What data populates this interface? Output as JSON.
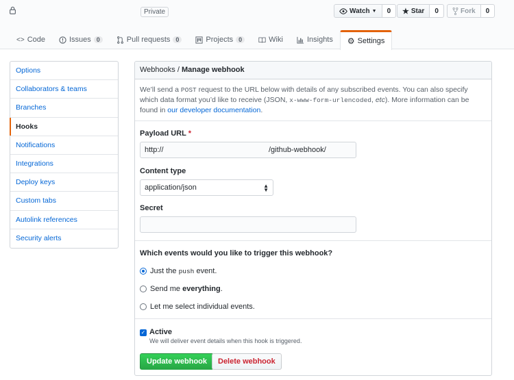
{
  "header": {
    "visibility_badge": "Private",
    "icons": {
      "lock": "lock-icon",
      "watch": "eye-icon",
      "star": "star-icon",
      "fork": "fork-icon"
    },
    "watch": {
      "label": "Watch",
      "count": "0"
    },
    "star": {
      "label": "Star",
      "count": "0"
    },
    "fork": {
      "label": "Fork",
      "count": "0"
    }
  },
  "tabs": [
    {
      "label": "Code",
      "icon": "code-icon"
    },
    {
      "label": "Issues",
      "count": "0",
      "icon": "issue-icon"
    },
    {
      "label": "Pull requests",
      "count": "0",
      "icon": "pull-request-icon"
    },
    {
      "label": "Projects",
      "count": "0",
      "icon": "project-icon"
    },
    {
      "label": "Wiki",
      "icon": "book-icon"
    },
    {
      "label": "Insights",
      "icon": "graph-icon"
    },
    {
      "label": "Settings",
      "icon": "gear-icon",
      "selected": true
    }
  ],
  "sidebar": {
    "items": [
      {
        "label": "Options"
      },
      {
        "label": "Collaborators & teams"
      },
      {
        "label": "Branches"
      },
      {
        "label": "Hooks",
        "selected": true
      },
      {
        "label": "Notifications"
      },
      {
        "label": "Integrations"
      },
      {
        "label": "Deploy keys"
      },
      {
        "label": "Custom tabs"
      },
      {
        "label": "Autolink references"
      },
      {
        "label": "Security alerts"
      }
    ]
  },
  "panel": {
    "breadcrumb_parent": "Webhooks",
    "breadcrumb_sep": " / ",
    "breadcrumb_current": "Manage webhook",
    "intro": {
      "t1": "We’ll send a ",
      "code1": "POST",
      "t2": " request to the URL below with details of any subscribed events. You can also specify which data format you’d like to receive (JSON, ",
      "code2": "x-www-form-urlencoded",
      "t3": ", ",
      "etc": "etc",
      "t4": "). More information can be found in ",
      "link": "our developer documentation",
      "t5": "."
    },
    "payload_label": "Payload URL",
    "required_mark": "*",
    "payload_value_start": "http://",
    "payload_value_end": "/github-webhook/",
    "content_type_label": "Content type",
    "content_type_value": "application/json",
    "secret_label": "Secret",
    "secret_value": "",
    "events_question": "Which events would you like to trigger this webhook?",
    "events": {
      "push": {
        "prefix": "Just the ",
        "code": "push",
        "suffix": " event.",
        "selected": true
      },
      "everything": {
        "prefix": "Send me ",
        "bold": "everything",
        "suffix": "."
      },
      "individual": {
        "label": "Let me select individual events."
      }
    },
    "active_label": "Active",
    "active_checked": true,
    "active_note": "We will deliver event details when this hook is triggered.",
    "update_button": "Update webhook",
    "delete_button": "Delete webhook"
  },
  "colors": {
    "accent": "#e36209",
    "link": "#0366d6",
    "primary_button": "#28a745",
    "danger": "#cb2431"
  }
}
